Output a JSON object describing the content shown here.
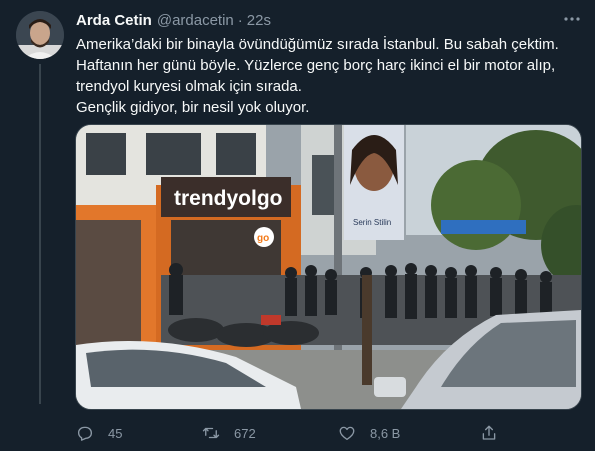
{
  "tweet": {
    "author": {
      "name": "Arda Cetin",
      "handle": "@ardacetin"
    },
    "separator": "·",
    "time": "22s",
    "lines": [
      "Amerika’daki bir binayla övündüğümüz sırada İstanbul. Bu sabah çektim.",
      "Haftanın her günü böyle. Yüzlerce genç borç harç ikinci el bir motor alıp,",
      "trendyol kuryesi olmak için sırada.",
      "Gençlik gidiyor, bir nesil yok oluyor."
    ],
    "media": {
      "store_sign": "trendyolgo",
      "badge": "go",
      "poster_caption": "Serin Stilin"
    },
    "actions": {
      "reply": {
        "icon": "reply-icon",
        "count": "45"
      },
      "retweet": {
        "icon": "retweet-icon",
        "count": "672"
      },
      "like": {
        "icon": "heart-icon",
        "count": "8,6 B"
      },
      "share": {
        "icon": "share-icon"
      }
    }
  },
  "colors": {
    "background": "#15202b",
    "text": "#f7f9f9",
    "muted": "#8b98a5",
    "border": "#38444d",
    "brand_orange": "#f27a1a"
  }
}
